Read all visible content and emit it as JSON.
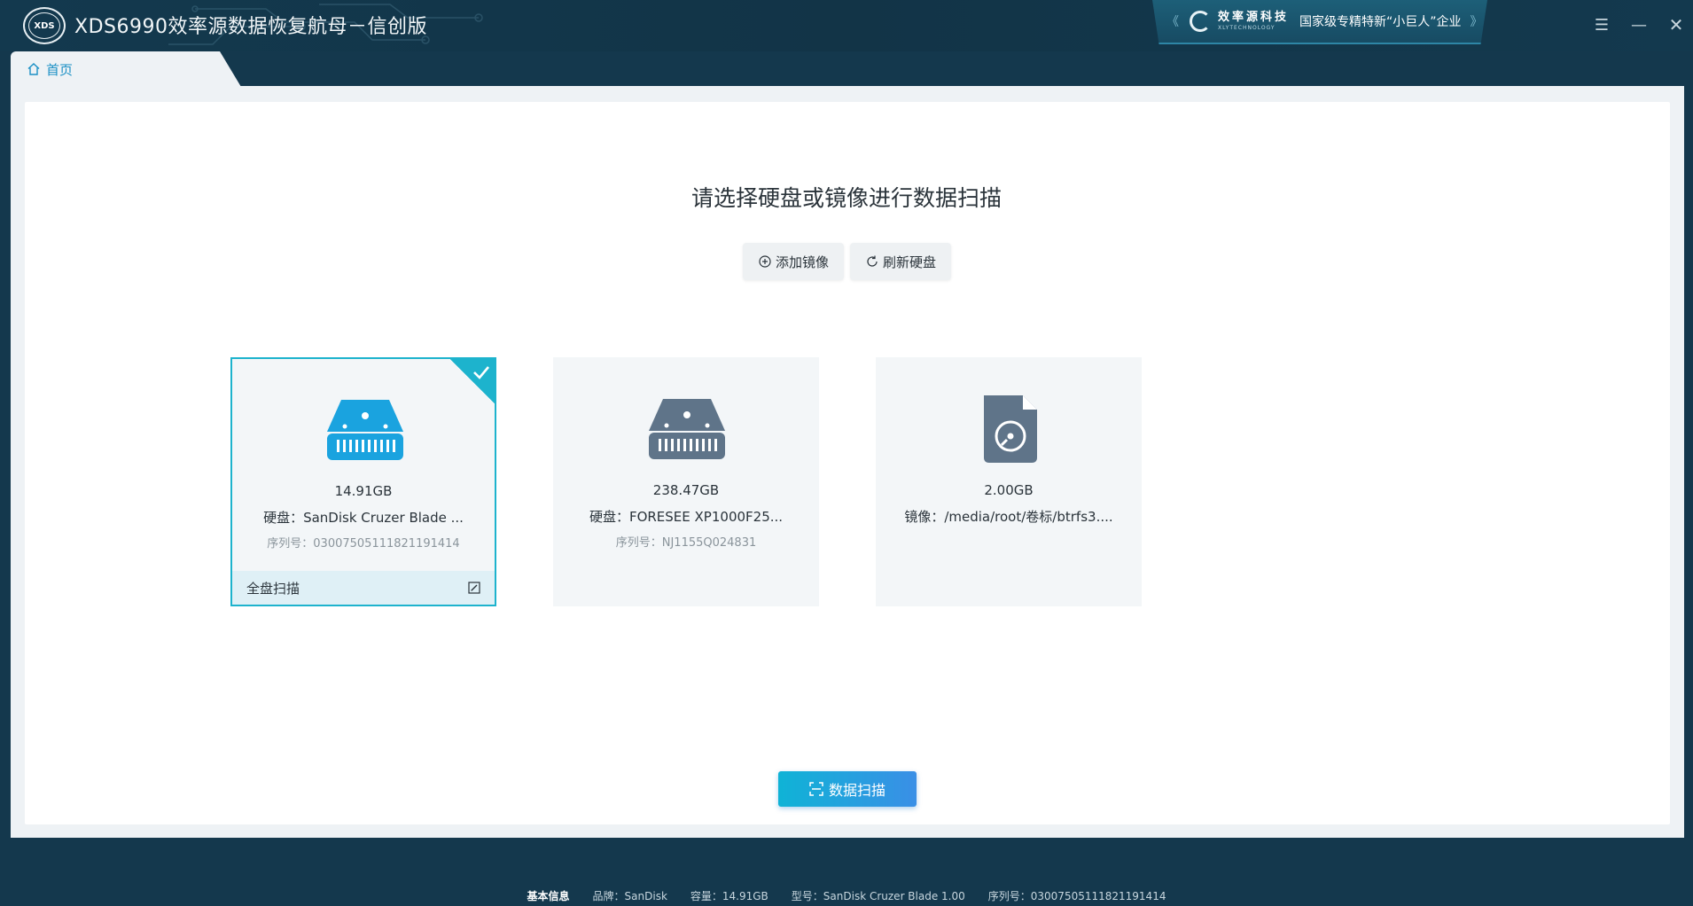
{
  "app": {
    "logo_text": "XDS",
    "title": "XDS6990效率源数据恢复航母－信创版"
  },
  "brand": {
    "name": "效率源科技",
    "sub": "XLYTECHNOLOGY",
    "slogan": "国家级专精特新“小巨人”企业"
  },
  "window_controls": {
    "menu": "☰",
    "minimize": "—",
    "close": "✕"
  },
  "tab": {
    "label": "首页"
  },
  "main": {
    "heading": "请选择硬盘或镜像进行数据扫描",
    "add_image_label": "添加镜像",
    "refresh_disk_label": "刷新硬盘",
    "scan_button_label": "数据扫描"
  },
  "disks": [
    {
      "kind": "disk",
      "size": "14.91GB",
      "name": "硬盘：SanDisk Cruzer Blade ...",
      "serial": "序列号：03007505111821191414",
      "selected": true,
      "footer_label": "全盘扫描",
      "icon": "hard-disk-icon",
      "color": "#1aa3df"
    },
    {
      "kind": "disk",
      "size": "238.47GB",
      "name": "硬盘：FORESEE XP1000F25...",
      "serial": "序列号：NJ1155Q024831",
      "selected": false,
      "icon": "hard-disk-icon",
      "color": "#5f7489"
    },
    {
      "kind": "image",
      "size": "2.00GB",
      "name": "镜像：/media/root/卷标/btrfs3....",
      "serial": "",
      "selected": false,
      "icon": "disk-image-icon",
      "color": "#5f7489"
    }
  ],
  "status": {
    "title": "基本信息",
    "brand": "品牌：SanDisk",
    "capacity": "容量：14.91GB",
    "model": "型号：SanDisk Cruzer Blade 1.00",
    "serial": "序列号：03007505111821191414"
  },
  "colors": {
    "accent": "#1db3cd",
    "frame": "#14384d",
    "panel": "#eef2f5"
  }
}
